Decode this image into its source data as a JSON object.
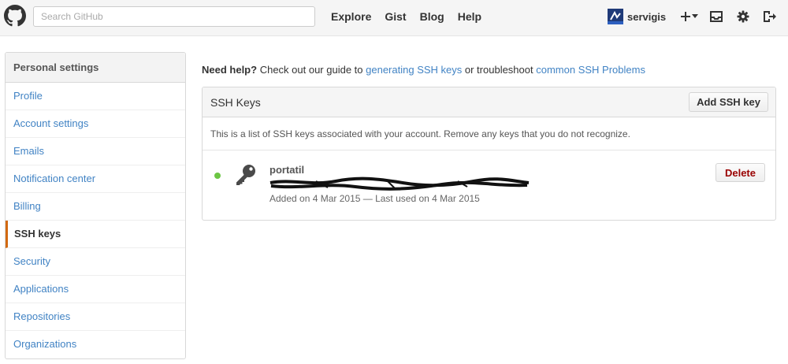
{
  "header": {
    "search_placeholder": "Search GitHub",
    "nav": [
      "Explore",
      "Gist",
      "Blog",
      "Help"
    ],
    "username": "servigis",
    "icons": [
      "github-logo-icon",
      "plus-icon",
      "chevron-down-icon",
      "inbox-icon",
      "gear-icon",
      "sign-out-icon"
    ]
  },
  "sidebar": {
    "title": "Personal settings",
    "items": [
      {
        "label": "Profile"
      },
      {
        "label": "Account settings"
      },
      {
        "label": "Emails"
      },
      {
        "label": "Notification center"
      },
      {
        "label": "Billing"
      },
      {
        "label": "SSH keys",
        "selected": true
      },
      {
        "label": "Security"
      },
      {
        "label": "Applications"
      },
      {
        "label": "Repositories"
      },
      {
        "label": "Organizations"
      }
    ]
  },
  "help": {
    "lead": "Need help?",
    "text1": "Check out our guide to",
    "link1": "generating SSH keys",
    "text2": "or troubleshoot",
    "link2": "common SSH Problems"
  },
  "ssh": {
    "title": "SSH Keys",
    "add_label": "Add SSH key",
    "description": "This is a list of SSH keys associated with your account. Remove any keys that you do not recognize.",
    "keys": [
      {
        "name": "portatil",
        "meta": "Added on 4 Mar 2015 — Last used on 4 Mar 2015",
        "delete_label": "Delete"
      }
    ]
  },
  "colors": {
    "link": "#4183c4",
    "selected_accent": "#d26911",
    "active_dot": "#6cc644",
    "danger": "#990000"
  }
}
